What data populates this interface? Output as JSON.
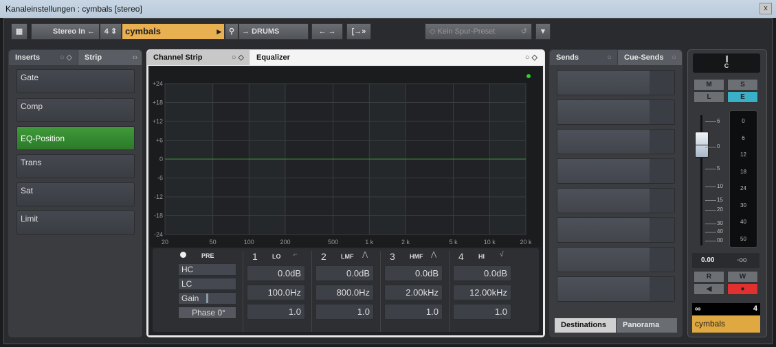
{
  "window": {
    "title": "Kanaleinstellungen : cymbals [stereo]",
    "close": "x"
  },
  "toolbar": {
    "input": "Stereo In",
    "channel_number": "4",
    "channel_name": "cymbals",
    "output": "DRUMS",
    "preset": "Kein Spur-Preset",
    "channel_color": "#e8b050"
  },
  "left_panel": {
    "tabs": [
      "Inserts",
      "Strip"
    ],
    "slots": [
      {
        "label": "Gate",
        "active": false
      },
      {
        "label": "Comp",
        "active": false
      },
      {
        "label": "EQ-Position",
        "active": true
      },
      {
        "label": "Trans",
        "active": false
      },
      {
        "label": "Sat",
        "active": false
      },
      {
        "label": "Limit",
        "active": false
      }
    ]
  },
  "center_panel": {
    "tabs": [
      "Channel Strip",
      "Equalizer"
    ],
    "active_tab": "Equalizer",
    "chart_data": {
      "type": "line",
      "x_scale": "log",
      "xlim": [
        20,
        20000
      ],
      "ylim": [
        -24,
        24
      ],
      "x_ticks": [
        "20",
        "50",
        "100",
        "200",
        "500",
        "1 k",
        "2 k",
        "5 k",
        "10 k",
        "20 k"
      ],
      "x_tick_values": [
        20,
        50,
        100,
        200,
        500,
        1000,
        2000,
        5000,
        10000,
        20000
      ],
      "y_ticks": [
        "+24",
        "+18",
        "+12",
        "+6",
        "0",
        "-6",
        "-12",
        "-18",
        "-24"
      ],
      "y_tick_values": [
        24,
        18,
        12,
        6,
        0,
        -6,
        -12,
        -18,
        -24
      ],
      "series": [
        {
          "x": [
            20,
            20000
          ],
          "y": [
            0,
            0
          ],
          "color": "#3d8f3d"
        }
      ],
      "grid": true
    },
    "pre": {
      "label": "PRE",
      "hc": "HC",
      "lc": "LC",
      "gain": "Gain",
      "phase": "Phase 0°"
    },
    "bands": [
      {
        "num": "1",
        "name": "LO",
        "gain": "0.0dB",
        "freq": "100.0Hz",
        "q": "1.0"
      },
      {
        "num": "2",
        "name": "LMF",
        "gain": "0.0dB",
        "freq": "800.0Hz",
        "q": "1.0"
      },
      {
        "num": "3",
        "name": "HMF",
        "gain": "0.0dB",
        "freq": "2.00kHz",
        "q": "1.0"
      },
      {
        "num": "4",
        "name": "HI",
        "gain": "0.0dB",
        "freq": "12.00kHz",
        "q": "1.0"
      }
    ]
  },
  "right_panel": {
    "tabs": [
      "Sends",
      "Cue-Sends"
    ],
    "bottom_tabs": [
      "Destinations",
      "Panorama"
    ],
    "active_bottom": "Destinations"
  },
  "fader_strip": {
    "pan": "C",
    "buttons": [
      "M",
      "S",
      "L",
      "E",
      "R",
      "W"
    ],
    "fader_scale": [
      "6",
      "0",
      "5",
      "10",
      "15",
      "20",
      "30",
      "40",
      "00"
    ],
    "meter_scale": [
      "0",
      "6",
      "12",
      "18",
      "24",
      "30",
      "40",
      "50"
    ],
    "volume": "0.00",
    "peak": "-oo",
    "number": "4",
    "name": "cymbals",
    "e_color": "#3ab0c8",
    "record_color": "#e03030"
  }
}
